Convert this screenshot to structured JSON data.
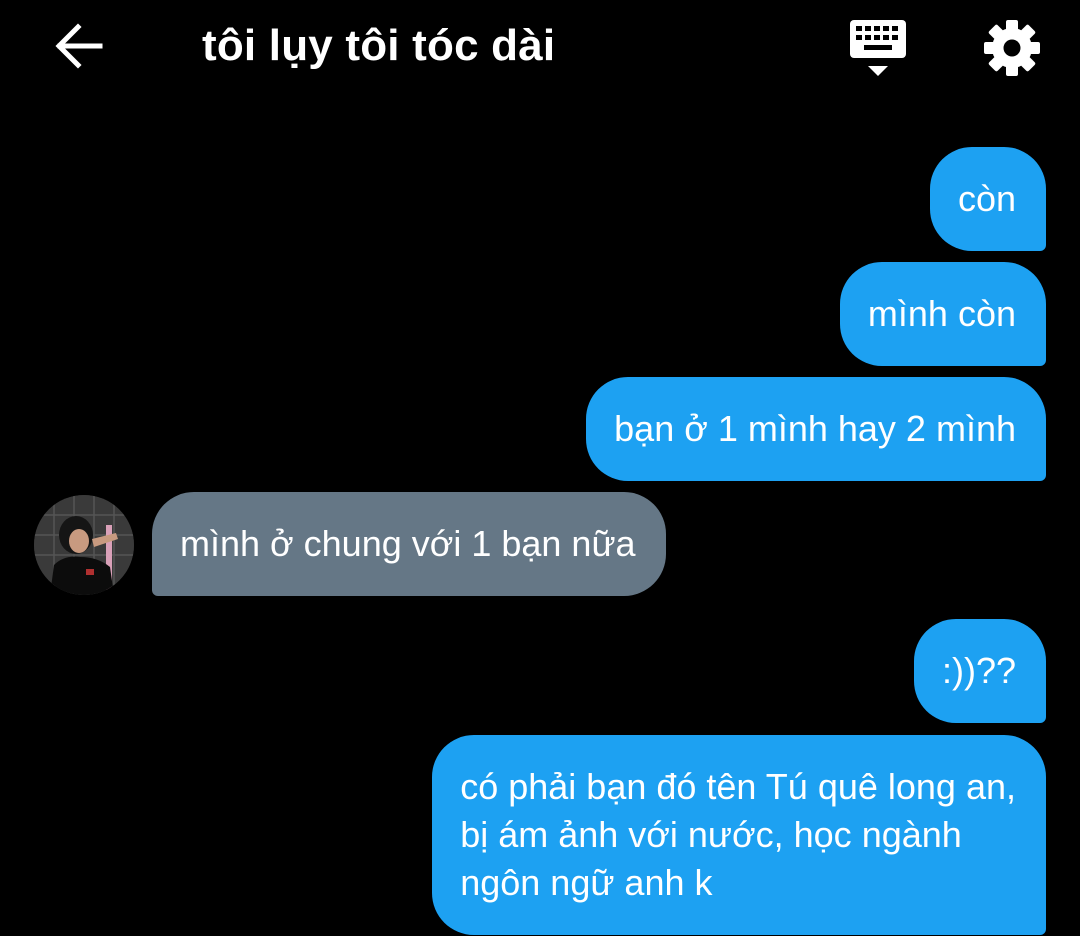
{
  "header": {
    "back_icon": "arrow-left-icon",
    "title": "tôi lụy tôi tóc dài",
    "keyboard_icon": "keyboard-icon",
    "settings_icon": "gear-icon"
  },
  "messages": [
    {
      "side": "out",
      "text": "còn"
    },
    {
      "side": "out",
      "text": "mình còn"
    },
    {
      "side": "out",
      "text": "bạn ở 1 mình hay 2 mình"
    },
    {
      "side": "in",
      "text": "mình ở chung với 1 bạn nữa"
    },
    {
      "side": "out",
      "text": ":))??"
    },
    {
      "side": "out",
      "text": "có phải bạn đó tên Tú quê long an,\nbị ám ảnh với nước, học ngành\nngôn ngữ anh k"
    }
  ],
  "colors": {
    "background": "#000000",
    "outgoing_bubble": "#1da1f2",
    "incoming_bubble": "#657786",
    "text": "#ffffff"
  }
}
